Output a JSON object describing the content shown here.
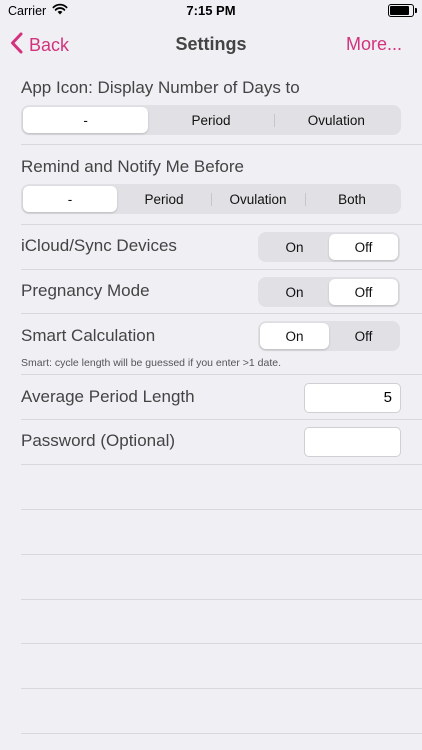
{
  "status_bar": {
    "carrier": "Carrier",
    "time": "7:15 PM"
  },
  "nav": {
    "back_label": "Back",
    "title": "Settings",
    "more_label": "More..."
  },
  "settings": {
    "app_icon": {
      "label": "App Icon: Display Number of Days to",
      "options": [
        "-",
        "Period",
        "Ovulation"
      ],
      "selected": "-"
    },
    "remind": {
      "label": "Remind and Notify Me Before",
      "options": [
        "-",
        "Period",
        "Ovulation",
        "Both"
      ],
      "selected": "-"
    },
    "icloud": {
      "label": "iCloud/Sync Devices",
      "on": "On",
      "off": "Off",
      "selected": "Off"
    },
    "pregnancy": {
      "label": "Pregnancy Mode",
      "on": "On",
      "off": "Off",
      "selected": "Off"
    },
    "smart_calc": {
      "label": "Smart Calculation",
      "on": "On",
      "off": "Off",
      "selected": "On",
      "hint": "Smart: cycle length will be guessed if you enter >1 date."
    },
    "avg_period": {
      "label": "Average Period Length",
      "value": "5"
    },
    "password": {
      "label": "Password (Optional)",
      "value": ""
    }
  },
  "colors": {
    "accent": "#d2337c",
    "background": "#efeff4",
    "separator": "#d8d8dc"
  }
}
